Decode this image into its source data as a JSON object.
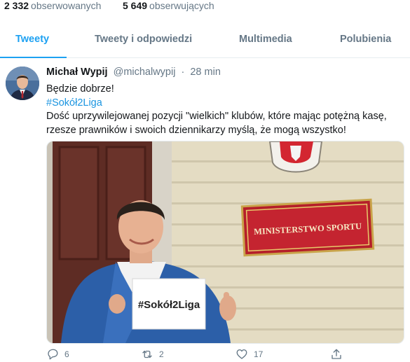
{
  "profile_stats": {
    "following_count": "2 332",
    "following_label": "obserwowanych",
    "followers_count": "5 649",
    "followers_label": "obserwujących"
  },
  "tabs": [
    {
      "label": "Tweety",
      "active": true
    },
    {
      "label": "Tweety i odpowiedzi",
      "active": false
    },
    {
      "label": "Multimedia",
      "active": false
    },
    {
      "label": "Polubienia",
      "active": false
    }
  ],
  "tweet": {
    "author_name": "Michał Wypij",
    "author_handle": "@michalwypij",
    "separator": "·",
    "time": "28 min",
    "line1": "Będzie dobrze!",
    "hashtag": "#Sokół2Liga",
    "line3": "Dość uprzywilejowanej pozycji \"wielkich\" klubów, które mając potężną kasę, rzesze prawników i swoich dziennikarzy myślą, że mogą wszystko!",
    "media": {
      "sign_text": "MINISTERSTWO SPORTU",
      "card_text": "#Sokół2Liga"
    },
    "actions": {
      "reply_count": "6",
      "retweet_count": "2",
      "like_count": "17"
    }
  },
  "colors": {
    "accent": "#1da1f2",
    "muted": "#657786",
    "text": "#14171a"
  }
}
